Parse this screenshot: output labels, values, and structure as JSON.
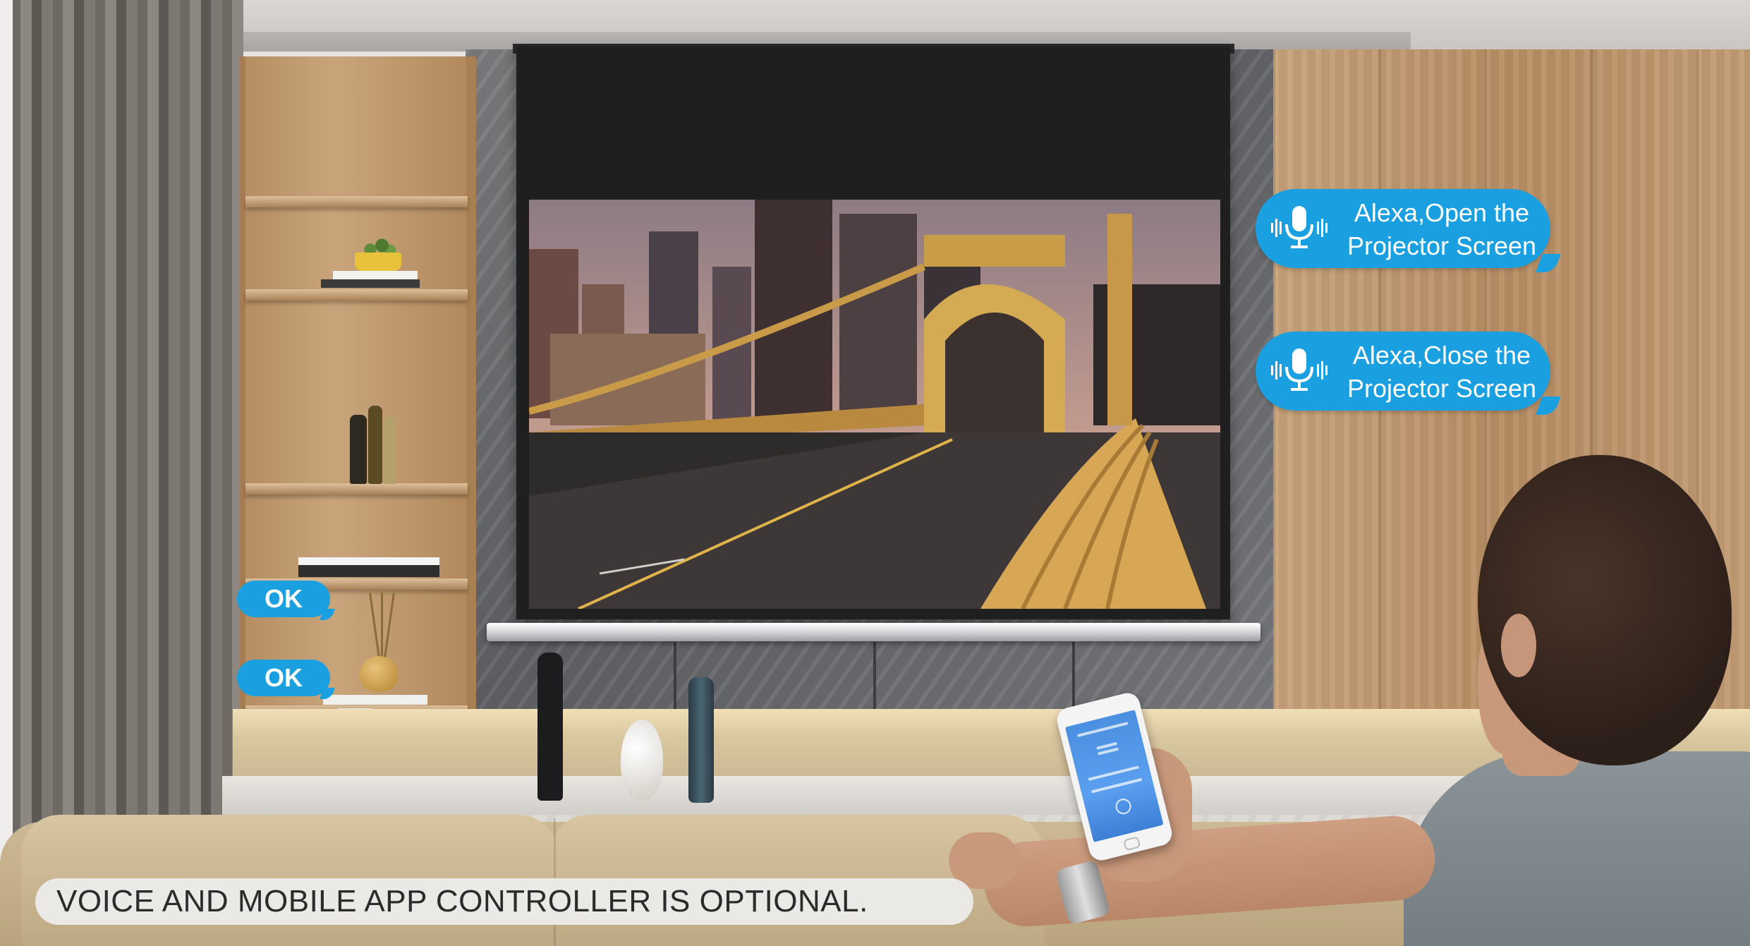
{
  "bubbles": {
    "open": {
      "line1": "Alexa,Open the",
      "line2": "Projector Screen",
      "icon": "microphone-icon"
    },
    "close": {
      "line1": "Alexa,Close the",
      "line2": "Projector Screen",
      "icon": "microphone-icon"
    }
  },
  "badges": {
    "ok_top": "OK",
    "ok_bottom": "OK"
  },
  "caption": "VOICE AND MOBILE APP CONTROLLER IS OPTIONAL.",
  "colors": {
    "bubble_blue": "#1aa0e0",
    "caption_bg": "#ecece9",
    "caption_text": "#2b2b2b"
  }
}
